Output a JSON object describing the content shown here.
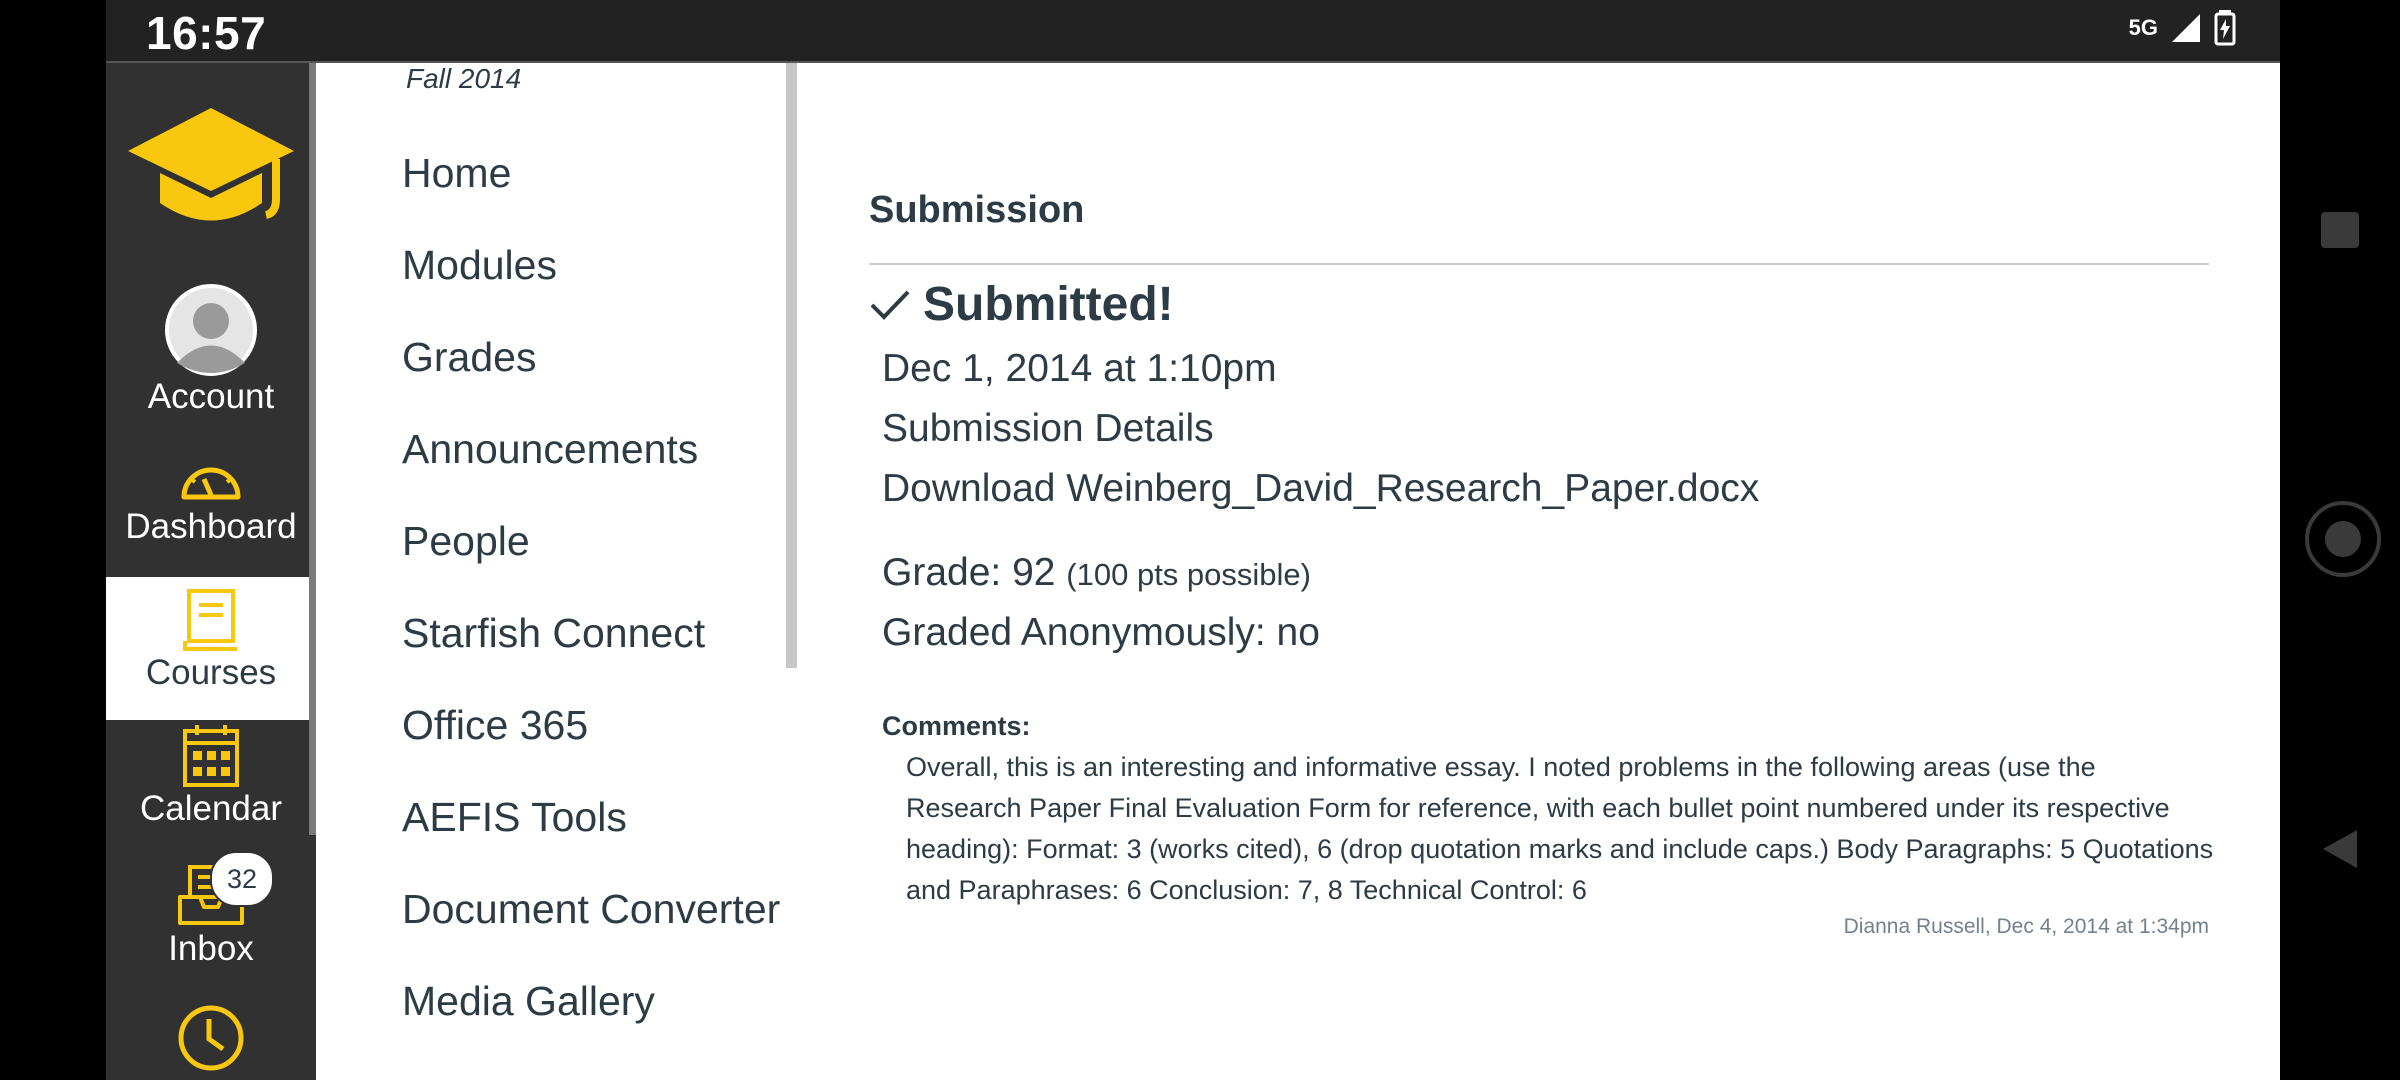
{
  "status": {
    "time": "16:57",
    "network": "5G"
  },
  "rail": {
    "items": [
      {
        "label": "Account"
      },
      {
        "label": "Dashboard"
      },
      {
        "label": "Courses"
      },
      {
        "label": "Calendar"
      },
      {
        "label": "Inbox",
        "badge": "32"
      }
    ]
  },
  "course_nav": {
    "term": "Fall 2014",
    "items": [
      "Home",
      "Modules",
      "Grades",
      "Announcements",
      "People",
      "Starfish Connect",
      "Office 365",
      "AEFIS Tools",
      "Document Converter",
      "Media Gallery"
    ]
  },
  "submission": {
    "heading": "Submission",
    "status": "Submitted!",
    "date": "Dec 1, 2014 at 1:10pm",
    "details_link": "Submission Details",
    "download_link": "Download Weinberg_David_Research_Paper.docx",
    "grade_label": "Grade: 92",
    "grade_possible": "(100 pts possible)",
    "anonymous": "Graded Anonymously: no",
    "comments_label": "Comments:",
    "comment_text": "Overall, this is an interesting and informative essay. I noted problems in the following areas (use the Research Paper Final Evaluation Form for reference, with each bullet point numbered under its respective heading): Format: 3 (works cited), 6 (drop quotation marks and include caps.) Body Paragraphs: 5 Quotations and Paraphrases: 6 Conclusion: 7, 8 Technical Control: 6",
    "comment_author": "Dianna Russell, Dec 4, 2014 at 1:34pm"
  },
  "colors": {
    "accent": "#f9c80e",
    "rail_bg": "#313131",
    "text": "#2d3b45"
  },
  "icons": [
    "logo-icon",
    "avatar-icon",
    "dashboard-icon",
    "courses-icon",
    "calendar-icon",
    "inbox-icon",
    "history-icon",
    "check-icon",
    "battery-icon",
    "signal-icon"
  ]
}
